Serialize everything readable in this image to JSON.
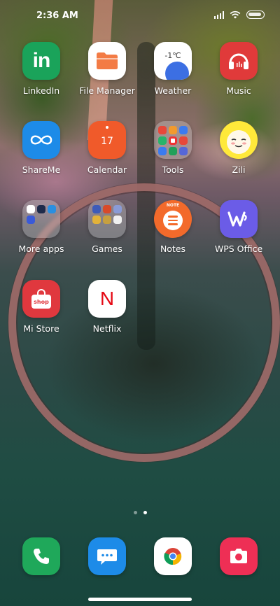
{
  "status_bar": {
    "time": "2:36 AM"
  },
  "apps": [
    {
      "label": "LinkedIn",
      "icon": "linkedin-icon",
      "color": "#1aa35a",
      "glyph": "in"
    },
    {
      "label": "File Manager",
      "icon": "folder-icon",
      "color": "#ffffff"
    },
    {
      "label": "Weather",
      "icon": "weather-icon",
      "color": "#ffffff",
      "temp": "-1℃"
    },
    {
      "label": "Music",
      "icon": "headphones-icon",
      "color": "#e03a3a"
    },
    {
      "label": "ShareMe",
      "icon": "shareme-icon",
      "color": "#1d8be8"
    },
    {
      "label": "Calendar",
      "icon": "calendar-icon",
      "color": "#f05a2a",
      "day": "17"
    },
    {
      "label": "Tools",
      "icon": "tools-folder-icon"
    },
    {
      "label": "Zili",
      "icon": "zili-icon",
      "color": "#ffe93a"
    },
    {
      "label": "More apps",
      "icon": "more-apps-folder-icon"
    },
    {
      "label": "Games",
      "icon": "games-folder-icon"
    },
    {
      "label": "Notes",
      "icon": "notes-icon",
      "color": "#f36a2b",
      "badge": "NOTE"
    },
    {
      "label": "WPS Office",
      "icon": "wps-office-icon",
      "color": "#6b5ce7"
    },
    {
      "label": "Mi Store",
      "icon": "mi-store-icon",
      "color": "#e0383e",
      "badge": "shop"
    },
    {
      "label": "Netflix",
      "icon": "netflix-icon",
      "color": "#ffffff",
      "glyph": "N"
    }
  ],
  "dock": [
    {
      "name": "phone-icon",
      "color": "#1fa85a"
    },
    {
      "name": "messages-icon",
      "color": "#1d8be8"
    },
    {
      "name": "chrome-icon",
      "color": "#ffffff"
    },
    {
      "name": "camera-icon",
      "color": "#ee2f55"
    }
  ],
  "page_indicator": {
    "pages": 2,
    "current": 2
  }
}
